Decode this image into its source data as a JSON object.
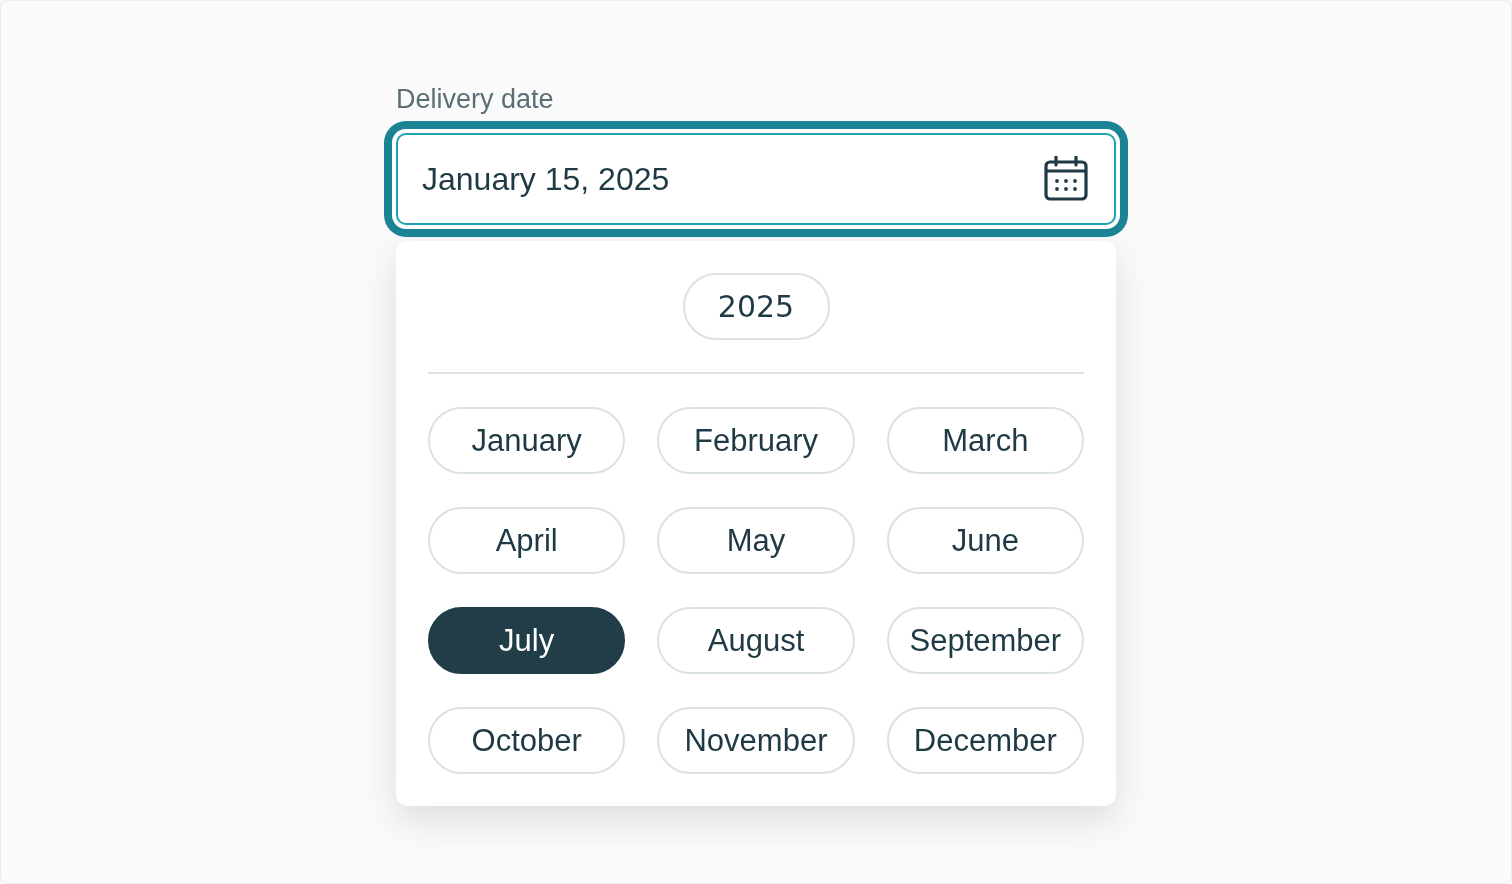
{
  "field": {
    "label": "Delivery date",
    "value": "January 15, 2025",
    "focused": true
  },
  "picker": {
    "year": "2025",
    "months": [
      {
        "label": "January",
        "selected": false
      },
      {
        "label": "February",
        "selected": false
      },
      {
        "label": "March",
        "selected": false
      },
      {
        "label": "April",
        "selected": false
      },
      {
        "label": "May",
        "selected": false
      },
      {
        "label": "June",
        "selected": false
      },
      {
        "label": "July",
        "selected": true
      },
      {
        "label": "August",
        "selected": false
      },
      {
        "label": "September",
        "selected": false
      },
      {
        "label": "October",
        "selected": false
      },
      {
        "label": "November",
        "selected": false
      },
      {
        "label": "December",
        "selected": false
      }
    ]
  }
}
